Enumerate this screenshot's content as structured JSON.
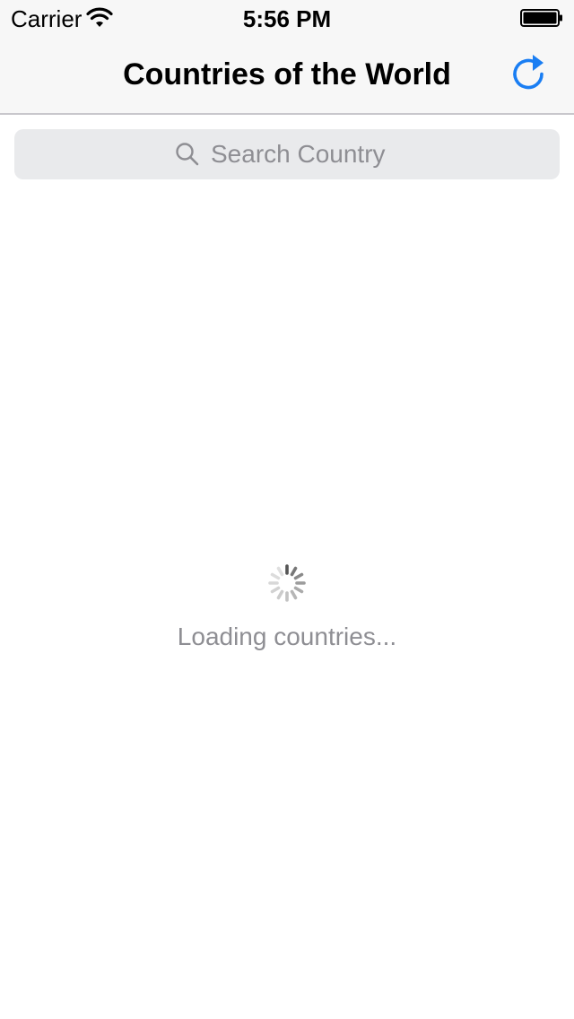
{
  "status_bar": {
    "carrier": "Carrier",
    "time": "5:56 PM",
    "wifi_icon": "wifi-icon",
    "battery_icon": "battery-full-icon"
  },
  "nav": {
    "title": "Countries of the World",
    "refresh_icon": "refresh-icon"
  },
  "search": {
    "placeholder": "Search Country",
    "value": "",
    "icon": "search-icon"
  },
  "loading": {
    "spinner_icon": "activity-spinner-icon",
    "text": "Loading countries..."
  },
  "colors": {
    "accent": "#1a7ef3",
    "bar_background": "#f7f7f7",
    "search_background": "#e9eaec",
    "muted_text": "#8e8e93"
  }
}
